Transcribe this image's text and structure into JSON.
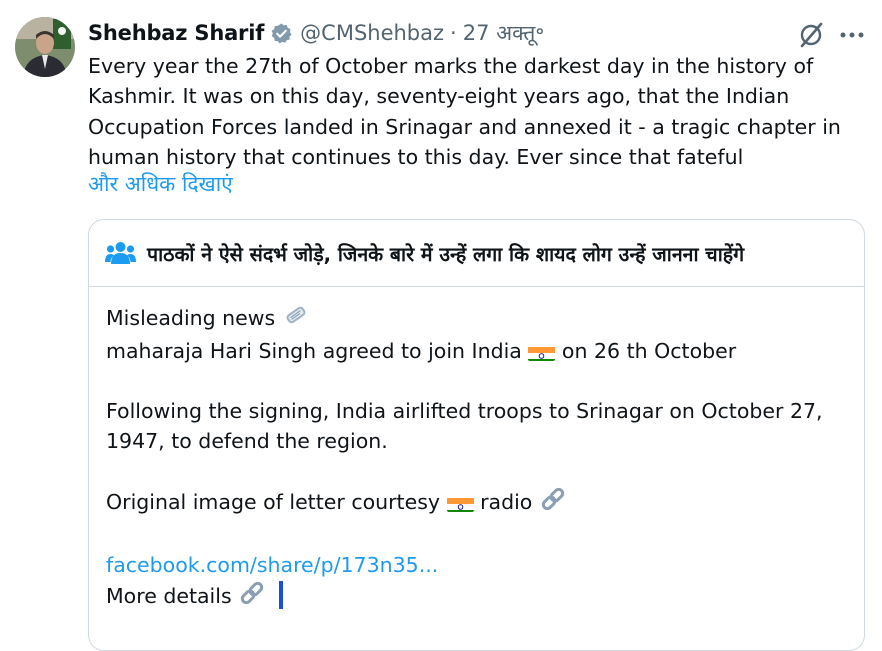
{
  "tweet": {
    "author_name": "Shehbaz Sharif",
    "handle": "@CMShehbaz",
    "separator": "·",
    "date": "27 अक्तू॰",
    "text": "Every year the 27th of October marks the darkest day in the history of Kashmir. It was on this day, seventy-eight years ago, that the Indian Occupation Forces landed in Srinagar and annexed it - a tragic chapter in human history that continues to this day. Ever since that fateful",
    "show_more": "और अधिक दिखाएं"
  },
  "icons": {
    "avatar": "profile-photo",
    "verified": "verified-badge-icon",
    "grok": "grok-icon",
    "more": "more-horizontal-icon",
    "people": "people-icon",
    "newspaper": "newspaper-icon",
    "flag": "india-flag-icon",
    "link": "link-icon"
  },
  "colors": {
    "accent": "#1d9bf0",
    "secondary_text": "#536471",
    "border": "#cfd9de",
    "verified_badge": "#829aab",
    "people_icon": "#1d9bf0"
  },
  "community_note": {
    "title": "पाठकों ने ऐसे संदर्भ जोड़े, जिनके बारे में उन्हें लगा कि शायद लोग उन्हें जानना चाहेंगे",
    "line1": "Misleading news",
    "line2_a": "maharaja Hari Singh agreed to join India",
    "line2_b": "on 26 th October",
    "para2_line1": "Following the signing, India airlifted troops to Srinagar on October 27,",
    "para2_line2": "1947, to defend the region.",
    "line3_a": "Original image of letter courtesy",
    "line3_b": "radio",
    "link": "facebook.com/share/p/173n35...",
    "more_details": "More details"
  }
}
